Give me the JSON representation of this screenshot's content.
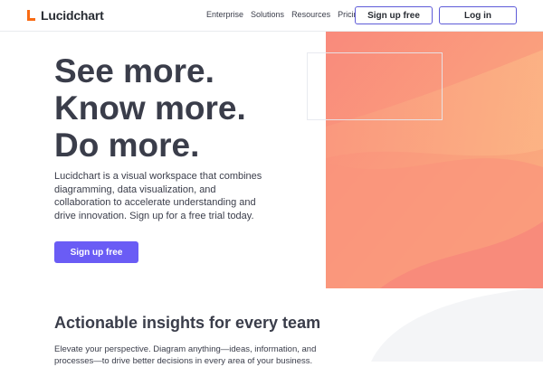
{
  "nav": {
    "brand": "Lucidchart",
    "links": [
      "Enterprise",
      "Solutions",
      "Resources",
      "Pricing"
    ],
    "signup_label": "Sign up free",
    "login_label": "Log in"
  },
  "hero": {
    "headline": [
      "See more.",
      "Know more.",
      "Do more."
    ],
    "description": "Lucidchart is a visual workspace that combines diagramming, data visualization, and collaboration to accelerate understanding and drive innovation. Sign up for a free trial today.",
    "cta_label": "Sign up free"
  },
  "section": {
    "title": "Actionable insights for every team",
    "text": "Elevate your perspective. Diagram anything—ideas, information, and processes—to drive better decisions in every area of your business."
  },
  "colors": {
    "accent": "#6a5cf5",
    "outline": "#5e5bd8",
    "logo": "#f96b13",
    "hero_bg": "#f88e79",
    "text": "#3a3d4a"
  }
}
